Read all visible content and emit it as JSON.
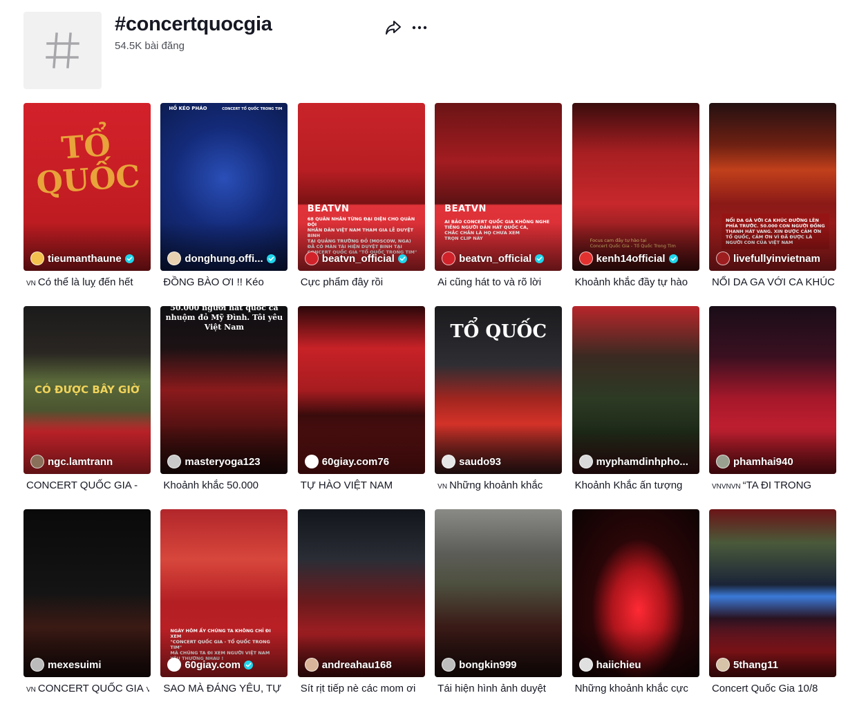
{
  "header": {
    "icon": "hashtag-icon",
    "title": "#concertquocgia",
    "subtitle": "54.5K bài đăng"
  },
  "actions": {
    "share": "share-icon",
    "more": "more-dots-icon"
  },
  "videos": [
    {
      "username": "tieumanthaune",
      "verified": true,
      "caption": "Có thể là luỵ đến hết",
      "prefix": "VN",
      "big": "TỔ QUỐC",
      "overlay": "",
      "brand": "",
      "bg": "linear-gradient(180deg,#d3212a 0%,#c41d23 55%,#b01a1f 100%)",
      "avatar": "#f2c14e"
    },
    {
      "username": "donghung.offi...",
      "verified": true,
      "caption": "ĐỒNG BÀO ƠI !! Kéo",
      "prefix": "",
      "big": "",
      "overlay": "",
      "brand": "",
      "top_left": "HỒ KÉO PHÁO",
      "top_right": "CONCERT TỔ QUỐC TRONG TIM",
      "bg": "radial-gradient(circle at 50% 45%,#2a4fb8 0%,#142b7a 45%,#0a1846 100%)",
      "avatar": "#e7d1b0"
    },
    {
      "username": "beatvn_official",
      "verified": true,
      "caption": "Cực phẩm đây rồi",
      "prefix": "",
      "big": "",
      "brand": "BEATVN",
      "overlay": "68 QUÂN NHÂN TỪNG ĐẠI DIỆN CHO QUÂN ĐỘI\nNHÂN DÂN VIỆT NAM THAM GIA LỄ DUYỆT BINH\nTẠI QUẢNG TRƯỜNG ĐỎ (MOSCOW, NGA)\nĐÃ CÓ MÀN TÁI HIỆN DUYỆT BINH TẠI\nCONCERT QUỐC GIA \"TỔ QUỐC TRONG TIM\"",
      "bg": "linear-gradient(180deg,#c8242a 0%,#b81e23 40%,#7a1214 60%,#e0333a 61%,#d42a31 100%)",
      "avatar": "#d1222a"
    },
    {
      "username": "beatvn_official",
      "verified": true,
      "caption": "Ai cũng hát to và rõ lời",
      "prefix": "",
      "big": "",
      "brand": "BEATVN",
      "overlay": "AI BẢO CONCERT QUỐC GIA KHÔNG NGHE\nTIẾNG NGƯỜI DÂN HÁT QUỐC CA,\nCHẮC CHẮN LÀ HỌ CHƯA XEM\nTRỌN CLIP NÀY",
      "bg": "linear-gradient(180deg,#6b1416 0%,#a31c20 35%,#5d1214 60%,#e0333a 61%,#d42a31 100%)",
      "avatar": "#d1222a"
    },
    {
      "username": "kenh14official",
      "verified": true,
      "caption": "Khoảnh khắc đầy tự hào",
      "prefix": "",
      "big": "",
      "overlay": "Focus cam đầy tự hào tại\nConcert Quốc Gia - Tổ Quốc Trong Tim",
      "brand": "",
      "bg": "linear-gradient(180deg,#3a0c0d 0%,#a81f22 30%,#c7282c 60%,#4a0f10 100%)",
      "avatar": "#e3312f"
    },
    {
      "username": "livefullyinvietnam",
      "verified": false,
      "caption": "NỔI DA GA VỚI CA KHÚC",
      "prefix": "",
      "big": "",
      "overlay": "NỔI DA GÀ VỚI CA KHÚC ĐƯỜNG LÊN\nPHÍA TRƯỚC. 50.000 CON NGƯỜI ĐỒNG\nTHANH HÁT VANG. XIN ĐƯỢC CẢM ƠN\nTỔ QUỐC, CẢM ƠN VÌ ĐÃ ĐƯỢC LÀ\nNGƯỜI CON CỦA VIỆT NAM",
      "brand": "",
      "bg": "linear-gradient(180deg,#241011 0%,#6e2012 25%,#c1401b 40%,#8b1a17 60%,#b01f22 100%)",
      "avatar": "#9e1d1f"
    },
    {
      "username": "ngc.lamtrann",
      "verified": false,
      "caption": "CONCERT QUỐC GIA -",
      "prefix": "",
      "big": "CÓ ĐƯỢC BÂY GIỜ",
      "overlay": "",
      "brand": "",
      "bg": "linear-gradient(180deg,#1b1b1b 0%,#2a2622 28%,#5a6a3a 45%,#4b5530 62%,#c5232a 75%,#d3262d 100%)",
      "avatar": "#8a6f5a"
    },
    {
      "username": "masteryoga123",
      "verified": false,
      "caption": "Khoảnh khắc 50.000",
      "prefix": "",
      "big": "50.000 người hát quốc ca\nnhuộm đỏ Mỹ Đình. Tôi yêu\nViệt Nam",
      "overlay": "",
      "brand": "",
      "bg": "linear-gradient(180deg,#0f0f12 0%,#1c1214 25%,#8a1a1c 50%,#4d1010 75%,#220a0a 100%)",
      "avatar": "#c9c9c9"
    },
    {
      "username": "60giay.com76",
      "verified": false,
      "caption": "TỰ HÀO VIỆT NAM",
      "prefix": "",
      "big": "",
      "overlay": "",
      "brand": "",
      "bg": "linear-gradient(180deg,#2b0709 0%,#c72227 25%,#a71c20 50%,#3a0b0c 65%,#6b1213 100%)",
      "avatar": "#ffffff"
    },
    {
      "username": "saudo93",
      "verified": false,
      "caption": "Những khoảnh khắc",
      "prefix": "VN",
      "big": "TỔ QUỐC",
      "overlay": "",
      "brand": "",
      "bg": "linear-gradient(180deg,#1b1b1e 0%,#2e2e33 35%,#a0251f 55%,#d33228 70%,#3a1a1a 100%)",
      "avatar": "#e6e6e6"
    },
    {
      "username": "myphamdinhpho...",
      "verified": false,
      "caption": "Khoảnh Khắc ấn tượng",
      "prefix": "",
      "big": "",
      "overlay": "",
      "brand": "",
      "bg": "linear-gradient(180deg,#b8262a 0%,#3a2a22 30%,#2d3a24 55%,#1e2a18 75%,#3a1214 100%)",
      "avatar": "#d9d9d9"
    },
    {
      "username": "phamhai940",
      "verified": false,
      "caption": "“TA ĐI TRONG",
      "prefix": "VNVNVN",
      "big": "",
      "overlay": "",
      "brand": "",
      "bg": "linear-gradient(180deg,#1a0d18 0%,#3a1020 30%,#a5182a 55%,#c32030 75%,#7a1018 100%)",
      "avatar": "#9aa08f"
    },
    {
      "username": "mexesuimi",
      "verified": false,
      "caption": "CONCERT QUỐC GIA",
      "prefix": "VN",
      "big": "",
      "overlay": "",
      "brand": "",
      "bg": "linear-gradient(180deg,#0a0a0a 0%,#141414 50%,#3b1a14 70%,#1a0b0b 100%)",
      "avatar": "#bbbbbb",
      "caption_suffix": "VN"
    },
    {
      "username": "60giay.com",
      "verified": true,
      "caption": "SAO MÀ ĐÁNG YÊU, TỰ",
      "prefix": "",
      "big": "",
      "overlay": "NGÀY HÔM ẤY CHÚNG TA KHÔNG CHỈ ĐI XEM\n\"CONCERT QUỐC GIA - TỔ QUỐC TRONG TIM\"\nMÀ CHÚNG TA ĐI XEM NGƯỜI VIỆT NAM\nYÊU THƯƠNG NHAU !",
      "brand": "",
      "bg": "linear-gradient(180deg,#b2262b 0%,#d8473c 30%,#b41f24 55%,#c02126 100%)",
      "avatar": "#ffffff"
    },
    {
      "username": "andreahau168",
      "verified": false,
      "caption": "Sít rịt tiếp nè các mom ơi",
      "prefix": "",
      "big": "",
      "overlay": "",
      "brand": "",
      "bg": "linear-gradient(180deg,#13151c 0%,#2b2d36 30%,#6a1a1c 55%,#a11e22 75%,#4a0e10 100%)",
      "avatar": "#d8b59a"
    },
    {
      "username": "bongkin999",
      "verified": false,
      "caption": "Tái hiện hình ảnh duyệt",
      "prefix": "",
      "big": "",
      "overlay": "",
      "brand": "",
      "bg": "linear-gradient(180deg,#8a8a86 0%,#5e5e5a 25%,#4d4f3e 45%,#3a1a16 70%,#1e0d0c 100%)",
      "avatar": "#bdbdbd"
    },
    {
      "username": "haiichieu",
      "verified": false,
      "caption": "Những khoảnh khắc cực",
      "prefix": "",
      "big": "",
      "overlay": "",
      "brand": "",
      "bg": "radial-gradient(ellipse at 52% 60%,#ff2a34 0%,#b0151c 28%,#2a0608 50%,#0c0303 100%)",
      "avatar": "#e0e0e0"
    },
    {
      "username": "5thang11",
      "verified": false,
      "caption": "Concert Quốc Gia 10/8",
      "prefix": "",
      "big": "",
      "overlay": "",
      "brand": "",
      "bg": "linear-gradient(180deg,#6b1416 0%,#4a5a3a 20%,#1a2438 45%,#3b7ad8 52%,#2a1220 65%,#a1181e 85%,#5e0e10 100%)",
      "avatar": "#d6c3a8"
    }
  ]
}
